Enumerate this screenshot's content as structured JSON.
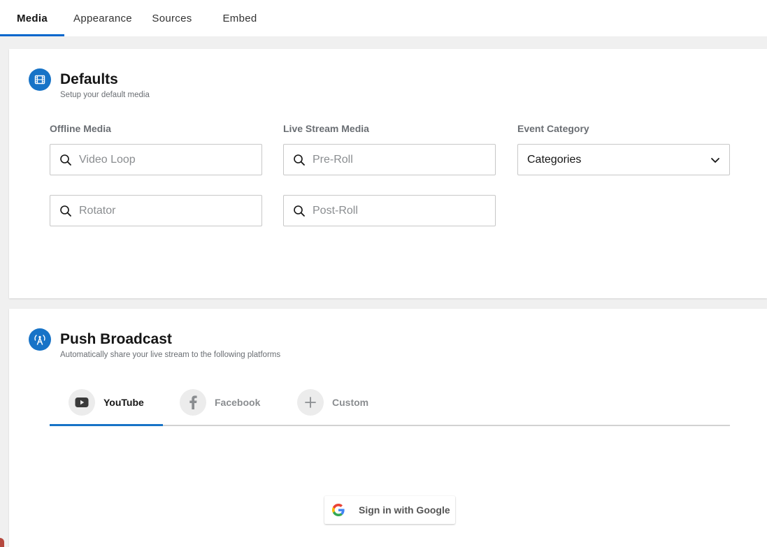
{
  "tabs": [
    {
      "label": "Media",
      "active": true
    },
    {
      "label": "Appearance"
    },
    {
      "label": "Sources"
    },
    {
      "label": "Embed"
    }
  ],
  "defaults": {
    "title": "Defaults",
    "subtitle": "Setup your default media",
    "icon": "film-icon",
    "offline_label": "Offline Media",
    "live_label": "Live Stream Media",
    "category_label": "Event Category",
    "video_loop_placeholder": "Video Loop",
    "rotator_placeholder": "Rotator",
    "preroll_placeholder": "Pre-Roll",
    "postroll_placeholder": "Post-Roll",
    "category_value": "Categories"
  },
  "broadcast": {
    "title": "Push Broadcast",
    "subtitle": "Automatically share your live stream to the following platforms",
    "icon": "broadcast-tower-icon",
    "platforms": [
      {
        "label": "YouTube",
        "icon": "youtube-icon",
        "active": true
      },
      {
        "label": "Facebook",
        "icon": "facebook-icon"
      },
      {
        "label": "Custom",
        "icon": "plus-icon"
      }
    ],
    "google_button": "Sign in with Google"
  },
  "colors": {
    "accent": "#1773c7",
    "tab_underline": "#0066cc"
  }
}
